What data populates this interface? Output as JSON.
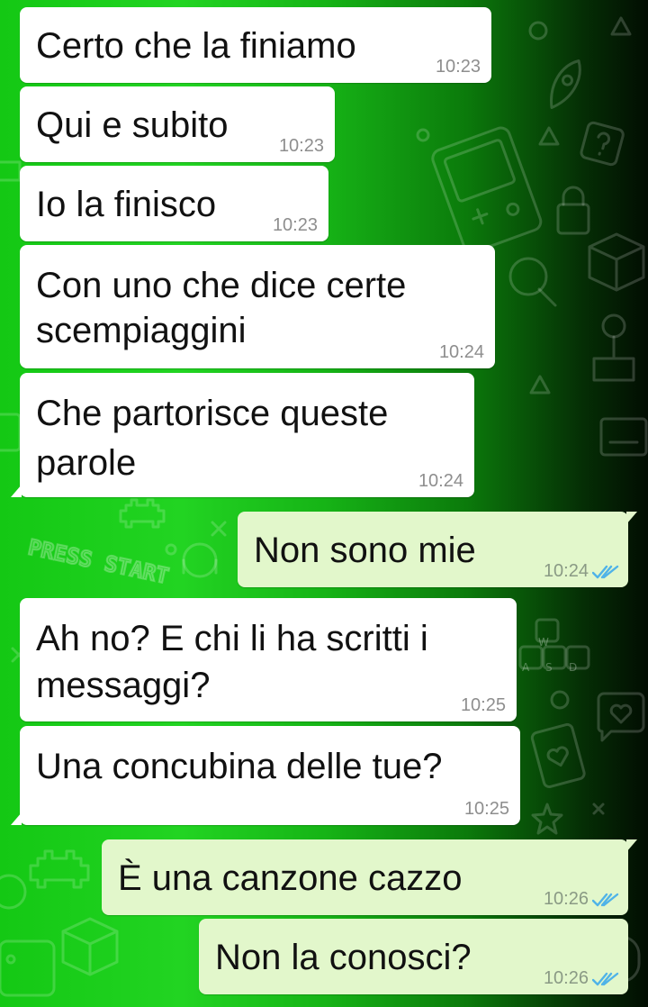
{
  "theme": {
    "incoming_bubble": "#ffffff",
    "outgoing_bubble": "#e2f7cb",
    "read_tick": "#4fb3e8",
    "wallpaper": "green gradient with doodle icons"
  },
  "doodles": {
    "press_start": "PRESS START",
    "key_w": "W",
    "key_a": "A",
    "key_s": "S",
    "key_d": "D"
  },
  "messages": [
    {
      "id": "m1",
      "dir": "in",
      "lines": [
        "Certo che la finiamo"
      ],
      "time": "10:23"
    },
    {
      "id": "m2",
      "dir": "in",
      "lines": [
        "Qui e subito"
      ],
      "time": "10:23"
    },
    {
      "id": "m3",
      "dir": "in",
      "lines": [
        "Io la finisco"
      ],
      "time": "10:23"
    },
    {
      "id": "m4",
      "dir": "in",
      "lines": [
        "Con uno che dice certe",
        "scempiaggini"
      ],
      "time": "10:24"
    },
    {
      "id": "m5",
      "dir": "in",
      "lines": [
        "Che partorisce queste",
        "parole"
      ],
      "time": "10:24"
    },
    {
      "id": "m6",
      "dir": "out",
      "lines": [
        "Non sono mie"
      ],
      "time": "10:24",
      "status": "read"
    },
    {
      "id": "m7",
      "dir": "in",
      "lines": [
        "Ah no? E chi li ha scritti i",
        "messaggi?"
      ],
      "time": "10:25"
    },
    {
      "id": "m8",
      "dir": "in",
      "lines": [
        "Una concubina delle tue?"
      ],
      "time": "10:25"
    },
    {
      "id": "m9",
      "dir": "out",
      "lines": [
        "È una canzone cazzo"
      ],
      "time": "10:26",
      "status": "read"
    },
    {
      "id": "m10",
      "dir": "out",
      "lines": [
        "Non la conosci?"
      ],
      "time": "10:26",
      "status": "read"
    }
  ]
}
